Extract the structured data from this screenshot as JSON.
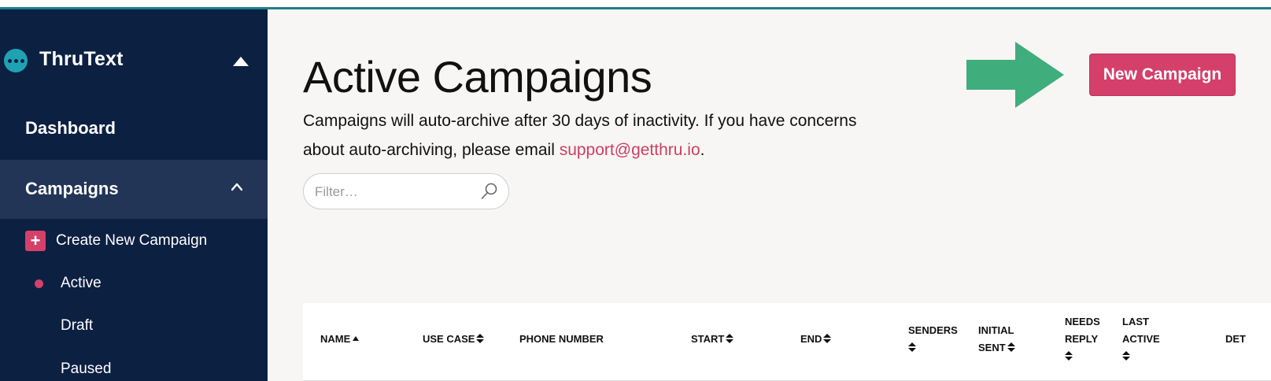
{
  "sidebar": {
    "brand": "ThruText",
    "dashboard": "Dashboard",
    "campaigns": "Campaigns",
    "create": "Create New Campaign",
    "items": [
      "Active",
      "Draft",
      "Paused"
    ]
  },
  "main": {
    "title": "Active Campaigns",
    "desc_line": "Campaigns will auto-archive after 30 days of inactivity. If you have concerns about auto-archiving, please email ",
    "support_email": "support@getthru.io",
    "desc_end": ".",
    "filter_placeholder": "Filter…",
    "new_button": "New Campaign"
  },
  "table": {
    "columns": {
      "name": "NAME",
      "use_case": "USE CASE",
      "phone": "PHONE NUMBER",
      "start": "START",
      "end": "END",
      "senders": "SENDERS",
      "initial_1": "INITIAL",
      "initial_2": "SENT",
      "needs_1": "NEEDS",
      "needs_2": "REPLY",
      "last_1": "LAST",
      "last_2": "ACTIVE",
      "details": "DET"
    }
  },
  "colors": {
    "sidebar": "#0c2042",
    "accent": "#d4406a",
    "arrow": "#3fad7c",
    "topline": "#1d7f8c"
  }
}
